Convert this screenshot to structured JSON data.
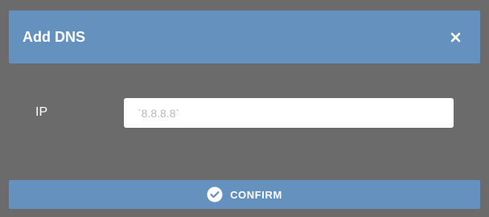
{
  "dialog": {
    "title": "Add DNS",
    "close_icon": "close-icon"
  },
  "form": {
    "ip_label": "IP",
    "ip_placeholder": "`8.8.8.8`",
    "ip_value": ""
  },
  "actions": {
    "confirm_label": "CONFIRM",
    "confirm_icon": "check-circle-icon"
  },
  "colors": {
    "backdrop": "#6b6b6b",
    "accent": "#6591bf",
    "text": "#ffffff",
    "placeholder": "#b8b8b8"
  }
}
